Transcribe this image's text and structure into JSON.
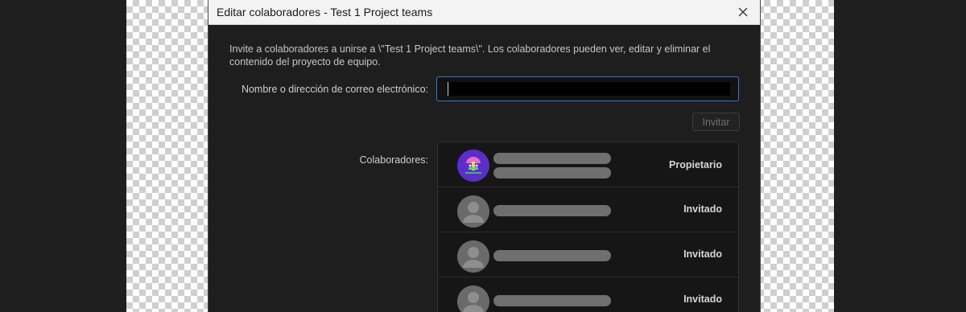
{
  "dialog": {
    "title": "Editar colaboradores - Test 1 Project teams",
    "close_icon": "close-icon",
    "description": "Invite a colaboradores a unirse a \\\"Test 1 Project teams\\\". Los colaboradores pueden ver, editar y eliminar el contenido del proyecto de equipo.",
    "name_label": "Nombre o dirección de correo electrónico:",
    "name_value": "",
    "invite_label": "Invitar",
    "collaborators_label": "Colaboradores:",
    "collaborators": [
      {
        "role": "Propietario",
        "avatar": "user-avatar-icon"
      },
      {
        "role": "Invitado",
        "avatar": "default-user-avatar-icon"
      },
      {
        "role": "Invitado",
        "avatar": "default-user-avatar-icon"
      },
      {
        "role": "Invitado",
        "avatar": "default-user-avatar-icon"
      }
    ]
  },
  "colors": {
    "background": "#1f1f1f",
    "dialog": "#1e1e1e",
    "titlebar": "#f3f3f3",
    "input_focus_border": "#3a78c9",
    "owner_avatar": "#5b2ec9"
  }
}
